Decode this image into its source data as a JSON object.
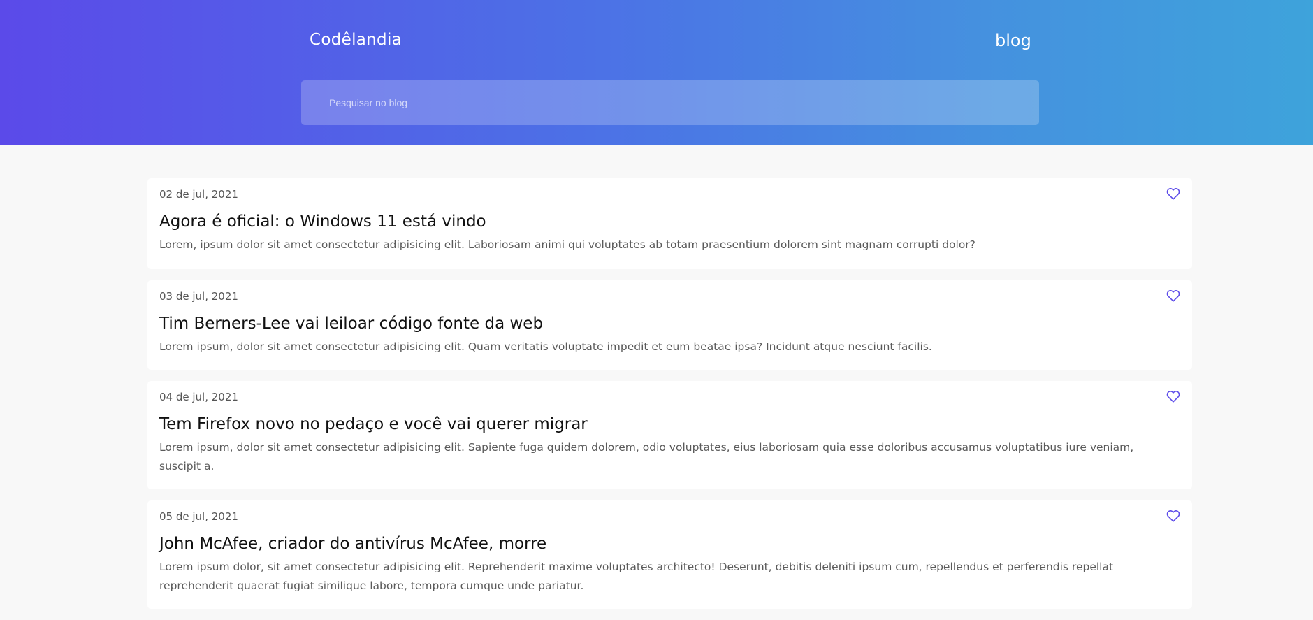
{
  "header": {
    "brand": "Codêlandia",
    "nav_link": "blog",
    "gradient": [
      "#5b4ae9",
      "#3ea3db"
    ]
  },
  "search": {
    "placeholder": "Pesquisar no blog",
    "value": ""
  },
  "posts": [
    {
      "date": "02 de jul, 2021",
      "title": "Agora é oficial: o Windows 11 está vindo",
      "excerpt": "Lorem, ipsum dolor sit amet consectetur adipisicing elit. Laboriosam animi qui voluptates ab totam praesentium dolorem sint magnam corrupti dolor?",
      "icon": "heart-outline-icon"
    },
    {
      "date": "03 de jul, 2021",
      "title": "Tim Berners-Lee vai leiloar código fonte da web",
      "excerpt": "Lorem ipsum, dolor sit amet consectetur adipisicing elit. Quam veritatis voluptate impedit et eum beatae ipsa? Incidunt atque nesciunt facilis.",
      "icon": "heart-outline-icon"
    },
    {
      "date": "04 de jul, 2021",
      "title": "Tem Firefox novo no pedaço e você vai querer migrar",
      "excerpt": "Lorem ipsum, dolor sit amet consectetur adipisicing elit. Sapiente fuga quidem dolorem, odio voluptates, eius laboriosam quia esse doloribus accusamus voluptatibus iure veniam, suscipit a.",
      "icon": "heart-outline-icon"
    },
    {
      "date": "05 de jul, 2021",
      "title": "John McAfee, criador do antivírus McAfee, morre",
      "excerpt": "Lorem ipsum dolor, sit amet consectetur adipisicing elit. Reprehenderit maxime voluptates architecto! Deserunt, debitis deleniti ipsum cum, repellendus et perferendis repellat reprehenderit quaerat fugiat similique labore, tempora cumque unde pariatur.",
      "icon": "heart-outline-icon"
    }
  ],
  "colors": {
    "accent": "#5b4ae9",
    "card_bg": "#ffffff",
    "page_bg": "#f8f8f8"
  }
}
